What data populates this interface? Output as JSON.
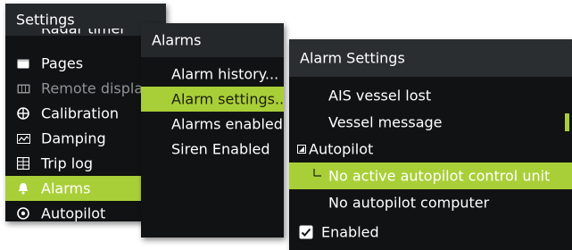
{
  "settings_panel": {
    "title": "Settings",
    "top_partial": "Radar timer",
    "items": [
      {
        "label": "Pages",
        "icon": "pages-icon"
      },
      {
        "label": "Remote displays",
        "icon": "remote-displays-icon",
        "disabled": true
      },
      {
        "label": "Calibration",
        "icon": "calibration-icon"
      },
      {
        "label": "Damping",
        "icon": "damping-icon"
      },
      {
        "label": "Trip log",
        "icon": "trip-log-icon"
      },
      {
        "label": "Alarms",
        "icon": "bell-icon",
        "selected": true
      },
      {
        "label": "Autopilot",
        "icon": "autopilot-icon"
      }
    ]
  },
  "alarms_panel": {
    "title": "Alarms",
    "items": [
      {
        "label": "Alarm history..."
      },
      {
        "label": "Alarm settings...",
        "selected": true
      },
      {
        "label": "Alarms enabled"
      },
      {
        "label": "Siren Enabled"
      }
    ]
  },
  "alarm_settings_panel": {
    "title": "Alarm Settings",
    "items": [
      {
        "label": "AIS vessel lost"
      },
      {
        "label": "Vessel message"
      },
      {
        "label": "Autopilot",
        "group": true,
        "expanded": true
      },
      {
        "label": "No active autopilot control unit",
        "selected": true
      },
      {
        "label": "No autopilot computer"
      },
      {
        "label": "Enabled",
        "checkbox": true,
        "checked": true
      }
    ]
  },
  "colors": {
    "accent": "#a9cf38",
    "panel_bg": "#111213",
    "header_bg": "#25282b",
    "text": "#ffffff"
  }
}
